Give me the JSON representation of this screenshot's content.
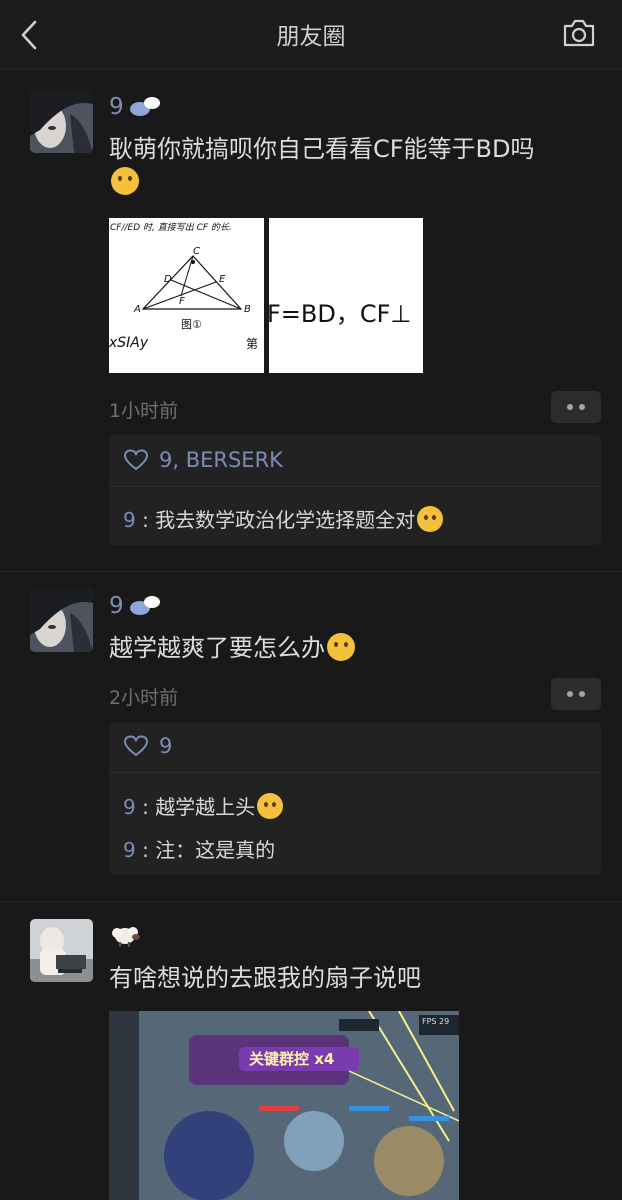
{
  "header": {
    "title": "朋友圈",
    "back_icon": "chevron-left-icon",
    "camera_icon": "camera-icon"
  },
  "posts": [
    {
      "nickname": "9",
      "text": "耿萌你就搞呗你自己看看CF能等于BD吗",
      "images": [
        {
          "top_text": "CF//ED 时, 直接写出 CF 的长.",
          "points": [
            "C",
            "D",
            "E",
            "A",
            "F",
            "B"
          ],
          "caption": "图①",
          "bottom_left": "xSIAy",
          "bottom_right": "第"
        },
        {
          "text": "F=BD，CF⊥"
        }
      ],
      "time": "1小时前",
      "likes": "9, BERSERK",
      "comments": [
        {
          "name": "9",
          "sep": " : ",
          "text": "我去数学政治化学选择题全对"
        }
      ]
    },
    {
      "nickname": "9",
      "text": "越学越爽了要怎么办",
      "time": "2小时前",
      "likes": "9",
      "comments": [
        {
          "name": "9",
          "sep": " : ",
          "text": "越学越上头"
        },
        {
          "name": "9",
          "sep": " : ",
          "text": "注：这是真的"
        }
      ]
    },
    {
      "nickname": "",
      "text": "有啥想说的去跟我的扇子说吧",
      "game": {
        "banner": "关键群控 x4",
        "fps": "FPS 29"
      }
    }
  ],
  "colors": {
    "background": "#191919",
    "name": "#7b8db4",
    "text": "#dcdcdc",
    "comment_bg": "#222222"
  }
}
